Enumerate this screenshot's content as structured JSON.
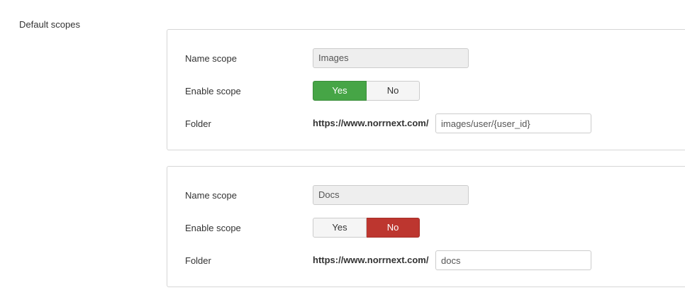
{
  "section": {
    "title": "Default scopes"
  },
  "scopes": [
    {
      "name_label": "Name scope",
      "name_value": "Images",
      "enable_label": "Enable scope",
      "yes_label": "Yes",
      "no_label": "No",
      "enabled": "Yes",
      "folder_label": "Folder",
      "url_prefix": "https://www.norrnext.com/",
      "folder_value": "images/user/{user_id}"
    },
    {
      "name_label": "Name scope",
      "name_value": "Docs",
      "enable_label": "Enable scope",
      "yes_label": "Yes",
      "no_label": "No",
      "enabled": "No",
      "folder_label": "Folder",
      "url_prefix": "https://www.norrnext.com/",
      "folder_value": "docs"
    }
  ],
  "colors": {
    "yes_active": "#46a546",
    "no_active": "#bd362f",
    "border": "#d6d6d6",
    "readonly_bg": "#eeeeee"
  }
}
